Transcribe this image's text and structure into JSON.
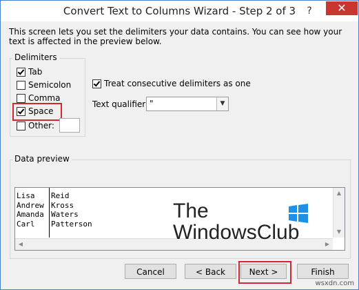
{
  "window": {
    "title": "Convert Text to Columns Wizard - Step 2 of 3",
    "help_label": "?",
    "close_label": "✕"
  },
  "intro": {
    "text": "This screen lets you set the delimiters your data contains.  You can see how your text is affected in the preview below."
  },
  "delimiters": {
    "legend": "Delimiters",
    "items": [
      {
        "label": "Tab",
        "checked": true
      },
      {
        "label": "Semicolon",
        "checked": false
      },
      {
        "label": "Comma",
        "checked": false
      },
      {
        "label": "Space",
        "checked": true
      },
      {
        "label": "Other:",
        "checked": false
      }
    ],
    "other_value": ""
  },
  "consecutive": {
    "label": "Treat consecutive delimiters as one",
    "checked": true
  },
  "qualifier": {
    "label": "Text qualifier:",
    "value": "\""
  },
  "preview": {
    "legend": "Data preview",
    "rows": [
      [
        "Lisa",
        "Reid"
      ],
      [
        "Andrew",
        "Kross"
      ],
      [
        "Amanda",
        "Waters"
      ],
      [
        "Carl",
        "Patterson"
      ]
    ]
  },
  "watermark": {
    "line1": "The",
    "line2": "WindowsClub"
  },
  "buttons": {
    "cancel": "Cancel",
    "back": "< Back",
    "next": "Next >",
    "finish": "Finish"
  },
  "footer": {
    "site": "wsxdn.com"
  },
  "colors": {
    "highlight": "#d0282e",
    "close_bg": "#c7372f",
    "window_border": "#4d80cc"
  }
}
